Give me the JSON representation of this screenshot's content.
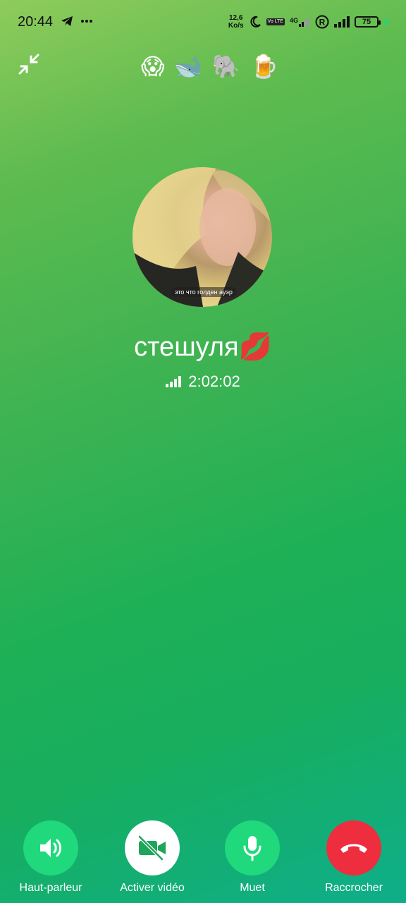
{
  "status_bar": {
    "time": "20:44",
    "net_speed_value": "12,6",
    "net_speed_unit": "Ko/s",
    "volte_label": "Vo LTE",
    "network_label": "4G",
    "roaming_label": "R",
    "battery_level": "75"
  },
  "emoji_key": [
    "😱",
    "🐋",
    "🐘",
    "🍺"
  ],
  "contact": {
    "name": "стешуля💋",
    "avatar_caption": "это что голден ауэр"
  },
  "call": {
    "duration": "2:02:02"
  },
  "controls": [
    {
      "label": "Haut-parleur",
      "icon": "speaker-icon",
      "color": "#1fd97c"
    },
    {
      "label": "Activer vidéo",
      "icon": "video-off-icon",
      "color": "#ffffff"
    },
    {
      "label": "Muet",
      "icon": "microphone-icon",
      "color": "#1fd97c"
    },
    {
      "label": "Raccrocher",
      "icon": "hang-up-icon",
      "color": "#ee2d3f"
    }
  ]
}
